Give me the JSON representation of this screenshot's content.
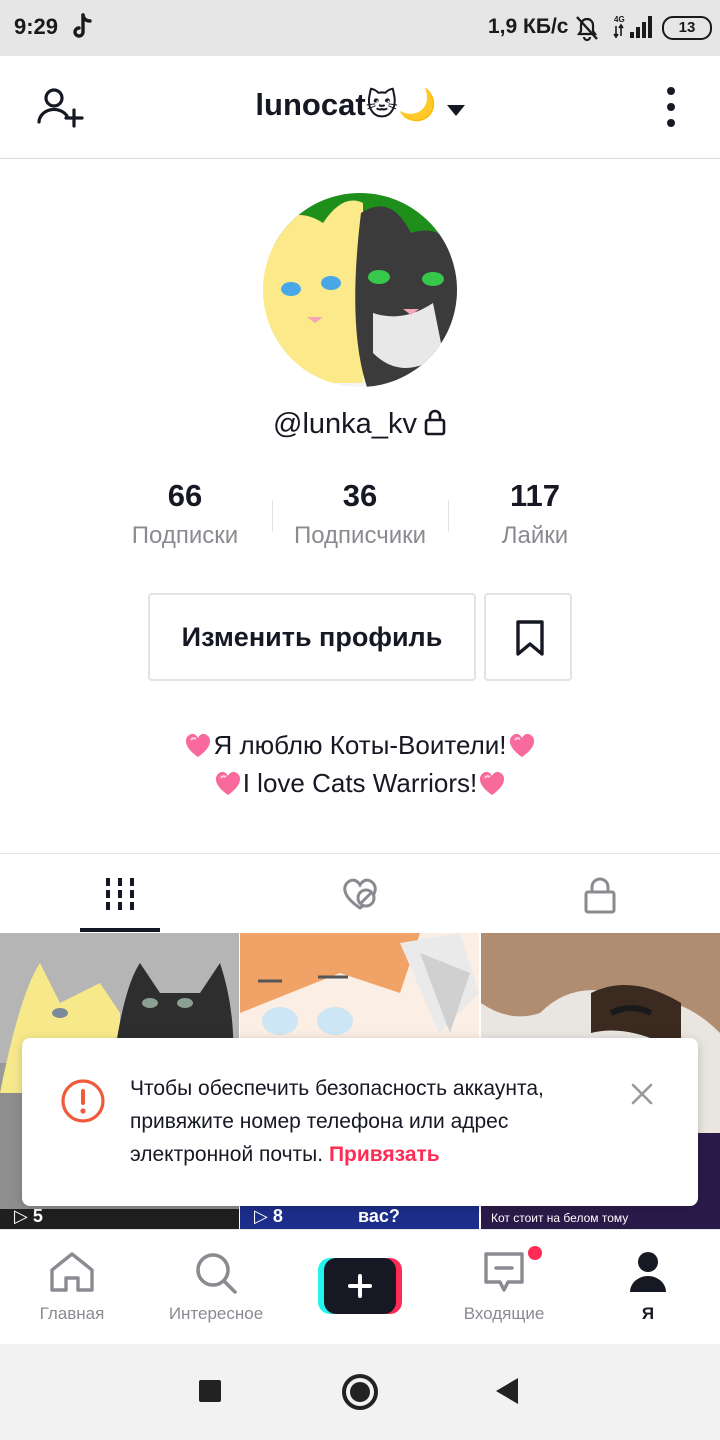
{
  "status_bar": {
    "time": "9:29",
    "net_speed": "1,9 КБ/с",
    "network": "4G",
    "battery": "13"
  },
  "header": {
    "username": "lunocat🐱🌙"
  },
  "profile": {
    "handle": "@lunka_kv",
    "stats": [
      {
        "value": "66",
        "label": "Подписки"
      },
      {
        "value": "36",
        "label": "Подписчики"
      },
      {
        "value": "117",
        "label": "Лайки"
      }
    ],
    "edit_button": "Изменить профиль",
    "bio_line1": "Я люблю Коты-Воители!",
    "bio_line2": "I love Cats Warriors!"
  },
  "videos": [
    {
      "views": "5"
    },
    {
      "views": "8",
      "caption": "вас?"
    },
    {
      "views": "",
      "caption": "Кот стоит на белом тому"
    }
  ],
  "toast": {
    "text": "Чтобы обеспечить безопасность аккаунта, привяжите номер телефона или адрес электронной почты.",
    "link": "Привязать"
  },
  "bottom_nav": [
    {
      "label": "Главная",
      "icon": "home-icon"
    },
    {
      "label": "Интересное",
      "icon": "search-icon"
    },
    {
      "label": "",
      "icon": "create-icon"
    },
    {
      "label": "Входящие",
      "icon": "inbox-icon"
    },
    {
      "label": "Я",
      "icon": "profile-icon"
    }
  ],
  "colors": {
    "accent": "#fe2c55",
    "cyan": "#25f4ee",
    "text_primary": "#161823",
    "text_secondary": "#8a8b91"
  }
}
